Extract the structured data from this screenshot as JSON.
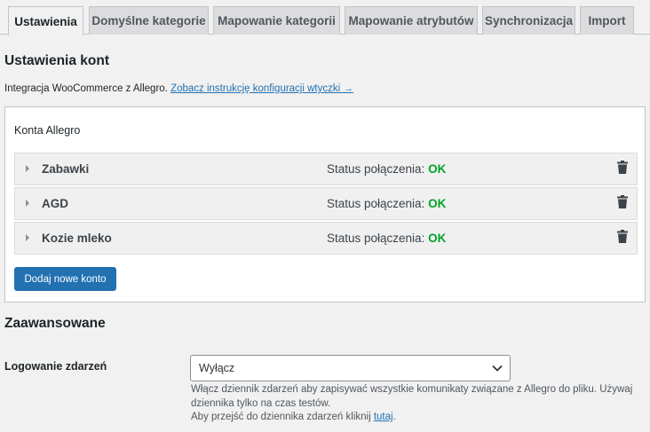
{
  "tabs": [
    {
      "label": "Ustawienia",
      "active": true
    },
    {
      "label": "Domyślne kategorie",
      "active": false
    },
    {
      "label": "Mapowanie kategorii",
      "active": false
    },
    {
      "label": "Mapowanie atrybutów",
      "active": false
    },
    {
      "label": "Synchronizacja",
      "active": false
    },
    {
      "label": "Import",
      "active": false
    }
  ],
  "accounts_section": {
    "title": "Ustawienia kont",
    "intro_text": "Integracja WooCommerce z Allegro.",
    "intro_link": "Zobacz instrukcję konfiguracji wtyczki →",
    "box_title": "Konta Allegro",
    "accounts": [
      {
        "name": "Zabawki",
        "status_label": "Status połączenia:",
        "status_value": "OK"
      },
      {
        "name": "AGD",
        "status_label": "Status połączenia:",
        "status_value": "OK"
      },
      {
        "name": "Kozie mleko",
        "status_label": "Status połączenia:",
        "status_value": "OK"
      }
    ],
    "add_button": "Dodaj nowe konto"
  },
  "advanced": {
    "title": "Zaawansowane",
    "logging_label": "Logowanie zdarzeń",
    "logging_value": "Wyłącz",
    "description_line1": "Włącz dziennik zdarzeń aby zapisywać wszystkie komunikaty związane z Allegro do pliku. Używaj dziennika tylko na czas testów.",
    "description_line2_prefix": "Aby przejść do dziennika zdarzeń kliknij",
    "description_line2_link": "tutaj",
    "description_line2_suffix": "."
  },
  "colors": {
    "accent": "#2271b1",
    "status_ok": "#00a32a",
    "background": "#f1f1f1"
  },
  "icons": {
    "account_toggle": "triangle-right-icon",
    "account_delete": "trash-icon",
    "select_dropdown": "chevron-down-icon"
  }
}
